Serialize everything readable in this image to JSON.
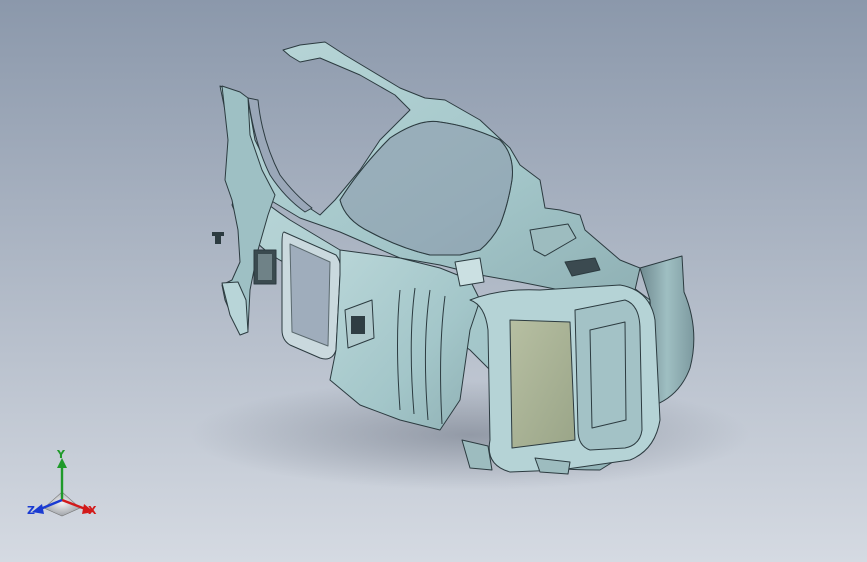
{
  "viewport": {
    "background_top": "#8b98ab",
    "background_bottom": "#d3d8e0",
    "part_color": "#a8cacd",
    "part_shade": "#8fb3b7",
    "part_edge": "#2c3b40",
    "glass_color": "#a9b496"
  },
  "triad": {
    "y_label": "Y",
    "x_label": "X",
    "z_label": "Z",
    "y_color": "#1f9a2a",
    "x_color": "#d21a1a",
    "z_color": "#1a3bd2"
  }
}
